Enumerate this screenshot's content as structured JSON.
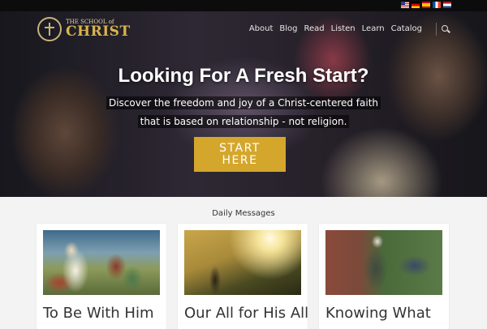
{
  "header": {
    "logo_small": "THE SCHOOL of",
    "logo_big": "CHRIST",
    "flags": [
      "flag-us-icon",
      "flag-de-icon",
      "flag-es-icon",
      "flag-fr-icon",
      "flag-nl-icon"
    ],
    "nav": [
      "About",
      "Blog",
      "Read",
      "Listen",
      "Learn",
      "Catalog"
    ]
  },
  "hero": {
    "title": "Looking For A Fresh Start?",
    "sub_line1": "Discover the freedom and joy of a Christ-centered faith",
    "sub_line2": "that is based on relationship - not religion.",
    "cta_line1": "START",
    "cta_line2": "HERE",
    "cta_color": "#d4a72c"
  },
  "daily": {
    "section_title": "Daily Messages",
    "cards": [
      {
        "title": "To Be With Him"
      },
      {
        "title": "Our All for His All"
      },
      {
        "title": "Knowing What"
      }
    ]
  }
}
